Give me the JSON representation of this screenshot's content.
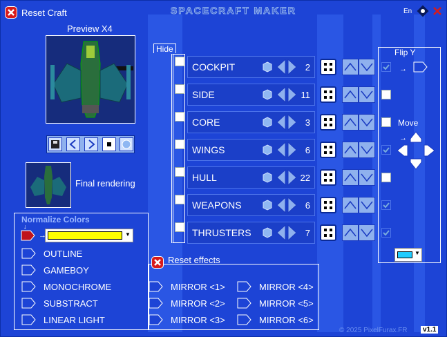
{
  "window": {
    "title": "SPACECRAFT MAKER",
    "reset_craft": "Reset Craft",
    "lang": "En"
  },
  "preview": {
    "label": "Preview X4",
    "final_label": "Final rendering"
  },
  "parts_panel": {
    "hide_label": "Hide"
  },
  "parts": [
    {
      "name": "COCKPIT",
      "value": "2",
      "hide": false,
      "flip": true
    },
    {
      "name": "SIDE",
      "value": "11",
      "hide": false,
      "flip": false
    },
    {
      "name": "CORE",
      "value": "3",
      "hide": false,
      "flip": false
    },
    {
      "name": "WINGS",
      "value": "6",
      "hide": false,
      "flip": true
    },
    {
      "name": "HULL",
      "value": "22",
      "hide": false,
      "flip": false
    },
    {
      "name": "WEAPONS",
      "value": "6",
      "hide": false,
      "flip": true
    },
    {
      "name": "THRUSTERS",
      "value": "7",
      "hide": false,
      "flip": true
    }
  ],
  "flip_panel": {
    "title": "Flip Y",
    "move_label": "Move"
  },
  "normalize": {
    "title": "Normalize Colors",
    "color": "#ffff00",
    "options": [
      "OUTLINE",
      "GAMEBOY",
      "MONOCHROME",
      "SUBSTRACT",
      "LINEAR LIGHT"
    ]
  },
  "effects": {
    "title": "Reset effects",
    "mirrors_col1": [
      "MIRROR <1>",
      "MIRROR <2>",
      "MIRROR <3>"
    ],
    "mirrors_col2": [
      "MIRROR <4>",
      "MIRROR <5>",
      "MIRROR <6>"
    ]
  },
  "footer": {
    "copyright": "© 2025 PixelFurax.FR",
    "version": "v1.1"
  },
  "colors": {
    "bg": "#1d44d6",
    "accent": "#d81b1b",
    "swatch": "#22ccff"
  }
}
